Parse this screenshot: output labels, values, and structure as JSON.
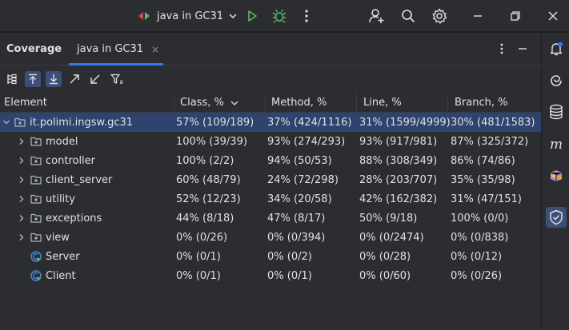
{
  "titlebar": {
    "run_config": "java in GC31",
    "icons": [
      "run-config-icon",
      "chevron-down-icon",
      "run-icon",
      "debug-icon",
      "more-vert-icon",
      "add-user-icon",
      "search-icon",
      "settings-icon",
      "minimize-icon",
      "restore-icon",
      "close-icon"
    ]
  },
  "tool_window": {
    "tab_coverage": "Coverage",
    "tab_run": "java in GC31",
    "tab_close": "×"
  },
  "table": {
    "headers": {
      "element": "Element",
      "class": "Class, %",
      "method": "Method, %",
      "line": "Line, %",
      "branch": "Branch, %"
    },
    "rows": [
      {
        "name": "it.polimi.ingsw.gc31",
        "class": "57% (109/189)",
        "method": "37% (424/1116)",
        "line": "31% (1599/4999)",
        "branch": "30% (481/1583)"
      },
      {
        "name": "model",
        "class": "100% (39/39)",
        "method": "93% (274/293)",
        "line": "93% (917/981)",
        "branch": "87% (325/372)"
      },
      {
        "name": "controller",
        "class": "100% (2/2)",
        "method": "94% (50/53)",
        "line": "88% (308/349)",
        "branch": "86% (74/86)"
      },
      {
        "name": "client_server",
        "class": "60% (48/79)",
        "method": "24% (72/298)",
        "line": "28% (203/707)",
        "branch": "35% (35/98)"
      },
      {
        "name": "utility",
        "class": "52% (12/23)",
        "method": "34% (20/58)",
        "line": "42% (162/382)",
        "branch": "31% (47/151)"
      },
      {
        "name": "exceptions",
        "class": "44% (8/18)",
        "method": "47% (8/17)",
        "line": "50% (9/18)",
        "branch": "100% (0/0)"
      },
      {
        "name": "view",
        "class": "0% (0/26)",
        "method": "0% (0/394)",
        "line": "0% (0/2474)",
        "branch": "0% (0/838)"
      },
      {
        "name": "Server",
        "class": "0% (0/1)",
        "method": "0% (0/2)",
        "line": "0% (0/28)",
        "branch": "0% (0/12)"
      },
      {
        "name": "Client",
        "class": "0% (0/1)",
        "method": "0% (0/1)",
        "line": "0% (0/60)",
        "branch": "0% (0/26)"
      }
    ]
  },
  "colors": {
    "accent": "#3574f0",
    "selected_row": "#2e436e",
    "run_green": "#5fb865",
    "bg": "#2b2d30"
  }
}
